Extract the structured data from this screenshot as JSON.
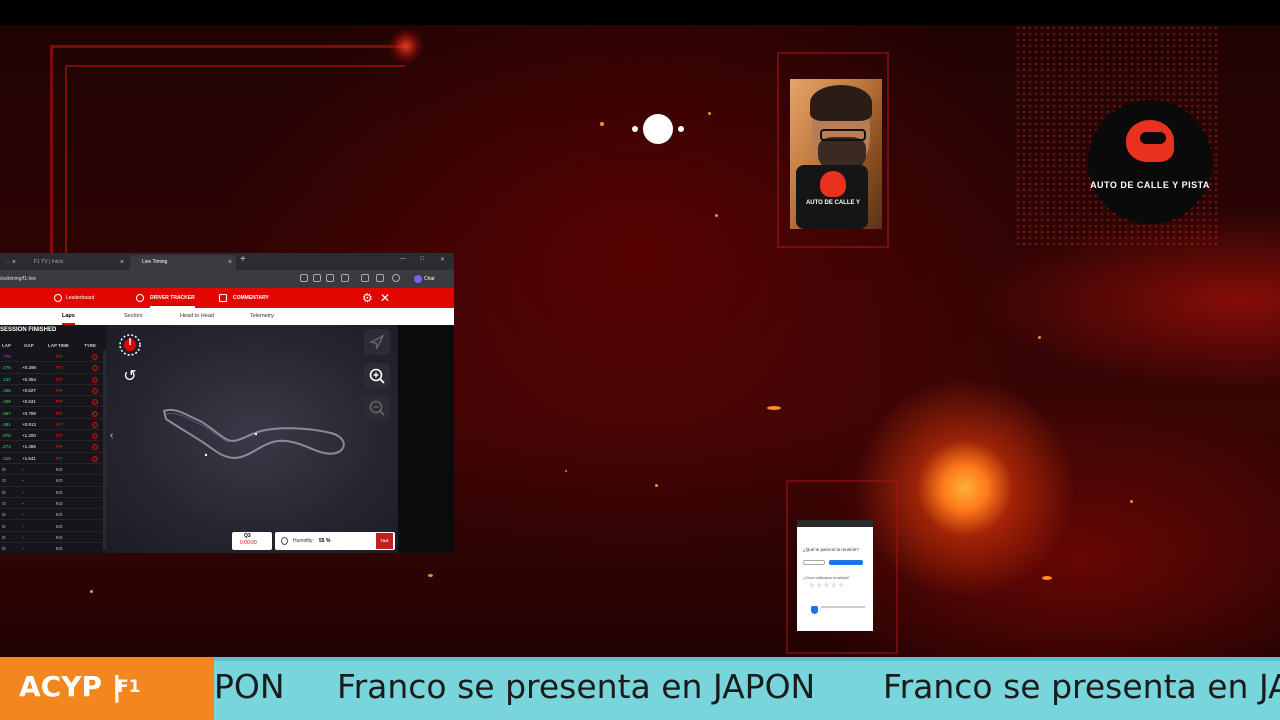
{
  "browser": {
    "tabs": [
      {
        "label": "..."
      },
      {
        "label": "F1 TV | Inicio"
      },
      {
        "label": "Live Timing"
      }
    ],
    "new_tab": "+",
    "url": "/es/timing/f1-live",
    "chat_label": "Chat"
  },
  "f1_app": {
    "nav": [
      {
        "label": "Leaderboard"
      },
      {
        "label": "DRIVER TRACKER"
      },
      {
        "label": "COMMENTARY"
      }
    ],
    "subtabs": [
      {
        "label": "Laps"
      },
      {
        "label": "Sectors"
      },
      {
        "label": "Head to Head"
      },
      {
        "label": "Telemetry"
      }
    ],
    "session_status": "SESSION FINISHED",
    "columns": [
      "LAP",
      "GAP",
      "LAP TIME",
      "TYRE"
    ],
    "rows": [
      {
        "lap": ".779",
        "gap": "",
        "lap_time": "PIT",
        "tyre": "S"
      },
      {
        "lap": ".076",
        "gap": "+0.298",
        "lap_time": "PIT",
        "tyre": "S"
      },
      {
        "lap": ".132",
        "gap": "+0.354",
        "lap_time": "PIT",
        "tyre": "S"
      },
      {
        "lap": ".405",
        "gap": "+0.627",
        "lap_time": "PIT",
        "tyre": "S"
      },
      {
        "lap": ".409",
        "gap": "+0.631",
        "lap_time": "PIT",
        "tyre": "S"
      },
      {
        "lap": ".567",
        "gap": "+0.789",
        "lap_time": "PIT",
        "tyre": "S"
      },
      {
        "lap": ".691",
        "gap": "+0.913",
        "lap_time": "PIT",
        "tyre": "S"
      },
      {
        "lap": ".978",
        "gap": "+1.200",
        "lap_time": "PIT",
        "tyre": "S"
      },
      {
        "lap": ".274",
        "gap": "+1.496",
        "lap_time": "PIT",
        "tyre": "S"
      },
      {
        "lap": ".319",
        "gap": "+1.541",
        "lap_time": "PIT",
        "tyre": "S"
      },
      {
        "lap": "O",
        "gap": "-",
        "lap_time": "KO",
        "tyre": ""
      },
      {
        "lap": "O",
        "gap": "-",
        "lap_time": "KO",
        "tyre": ""
      },
      {
        "lap": "O",
        "gap": "-",
        "lap_time": "KO",
        "tyre": ""
      },
      {
        "lap": "O",
        "gap": "-",
        "lap_time": "KO",
        "tyre": ""
      },
      {
        "lap": "O",
        "gap": "-",
        "lap_time": "KO",
        "tyre": ""
      },
      {
        "lap": "O",
        "gap": "-",
        "lap_time": "KO",
        "tyre": ""
      },
      {
        "lap": "O",
        "gap": "-",
        "lap_time": "KO",
        "tyre": ""
      },
      {
        "lap": "O",
        "gap": "-",
        "lap_time": "KO",
        "tyre": ""
      }
    ],
    "session_badge": "Q3",
    "session_timer": "0:00:00",
    "humidity_label": "Humidity:",
    "humidity_value": "55 %",
    "sponsor": "TAG"
  },
  "overlay": {
    "brand_text": "AUTO DE CALLE Y PISTA",
    "mic_text": "AUTO DE CALLE Y"
  },
  "phone": {
    "title": "¿Qué te pareció la reunión?",
    "question": "¿Cómo calificarías la calidad?",
    "stars": "☆☆☆☆☆"
  },
  "ticker": {
    "label_main": "ACYP |",
    "label_sub": "F1",
    "message_partial": "PON",
    "message": "Franco se presenta en JAPON",
    "message_cut": "Franco se presenta en JA"
  },
  "colors": {
    "f1_red": "#e10600",
    "ticker_bg": "#78d5dc",
    "ticker_label_bg": "#f3861e"
  }
}
